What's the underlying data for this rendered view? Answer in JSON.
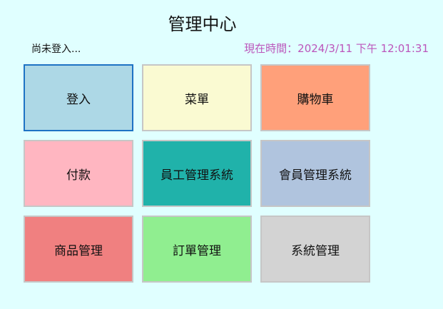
{
  "header": {
    "title": "管理中心",
    "login_status": "尚未登入...",
    "clock_label": "現在時間：",
    "clock_value": "2024/3/11 下午 12:01:31"
  },
  "tiles": [
    {
      "label": "登入",
      "color": "#add8e6"
    },
    {
      "label": "菜單",
      "color": "#fafad2"
    },
    {
      "label": "購物車",
      "color": "#ffa07a"
    },
    {
      "label": "付款",
      "color": "#ffb6c1"
    },
    {
      "label": "員工管理系統",
      "color": "#20b2aa"
    },
    {
      "label": "會員管理系統",
      "color": "#b0c4de"
    },
    {
      "label": "商品管理",
      "color": "#f08080"
    },
    {
      "label": "訂單管理",
      "color": "#90ee90"
    },
    {
      "label": "系統管理",
      "color": "#d3d3d3"
    }
  ],
  "colors": {
    "background": "#e0ffff",
    "clock": "#bb55bb",
    "active_border": "#1e73c4"
  }
}
